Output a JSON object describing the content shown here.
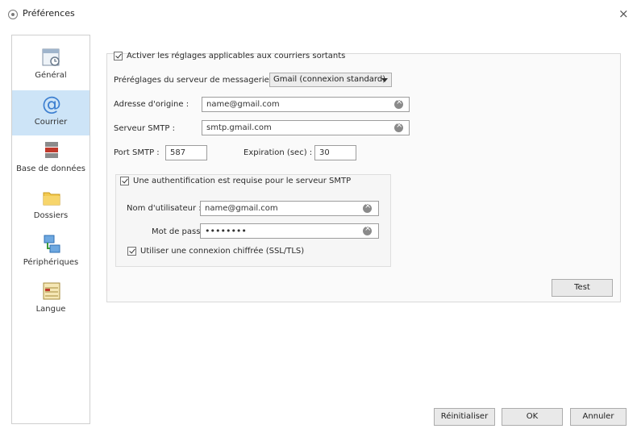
{
  "window": {
    "title": "Préférences",
    "close_glyph": "×"
  },
  "sidebar": {
    "items": [
      {
        "label": "Général",
        "icon": "general-settings-icon"
      },
      {
        "label": "Courrier",
        "icon": "at-sign-mail-icon"
      },
      {
        "label": "Base de données",
        "icon": "database-icon"
      },
      {
        "label": "Dossiers",
        "icon": "folder-icon"
      },
      {
        "label": "Périphériques",
        "icon": "network-devices-icon"
      },
      {
        "label": "Langue",
        "icon": "language-icon"
      }
    ],
    "active_index": 1
  },
  "mail": {
    "enable_outgoing_label": "Activer les réglages applicables aux courriers sortants",
    "enable_outgoing_checked": true,
    "server_preset_label": "Préréglages du serveur de messagerie :",
    "server_preset_value": "Gmail (connexion standard)",
    "origin_address_label": "Adresse d'origine :",
    "origin_address_value": "name@gmail.com",
    "smtp_server_label": "Serveur SMTP :",
    "smtp_server_value": "smtp.gmail.com",
    "smtp_port_label": "Port SMTP :",
    "smtp_port_value": "587",
    "timeout_label": "Expiration (sec) :",
    "timeout_value": "30",
    "auth_required_label": "Une authentification est requise pour le serveur SMTP",
    "auth_required_checked": true,
    "username_label": "Nom d'utilisateur :",
    "username_value": "name@gmail.com",
    "password_label": "Mot de passe :",
    "password_value": "••••••••",
    "ssl_label": "Utiliser une connexion chiffrée (SSL/TLS)",
    "ssl_checked": true,
    "test_button": "Test"
  },
  "footer": {
    "reset_button": "Réinitialiser",
    "ok_button": "OK",
    "cancel_button": "Annuler"
  },
  "colors": {
    "active_nav_bg": "#cde4f7",
    "panel_bg": "#fafafa"
  }
}
